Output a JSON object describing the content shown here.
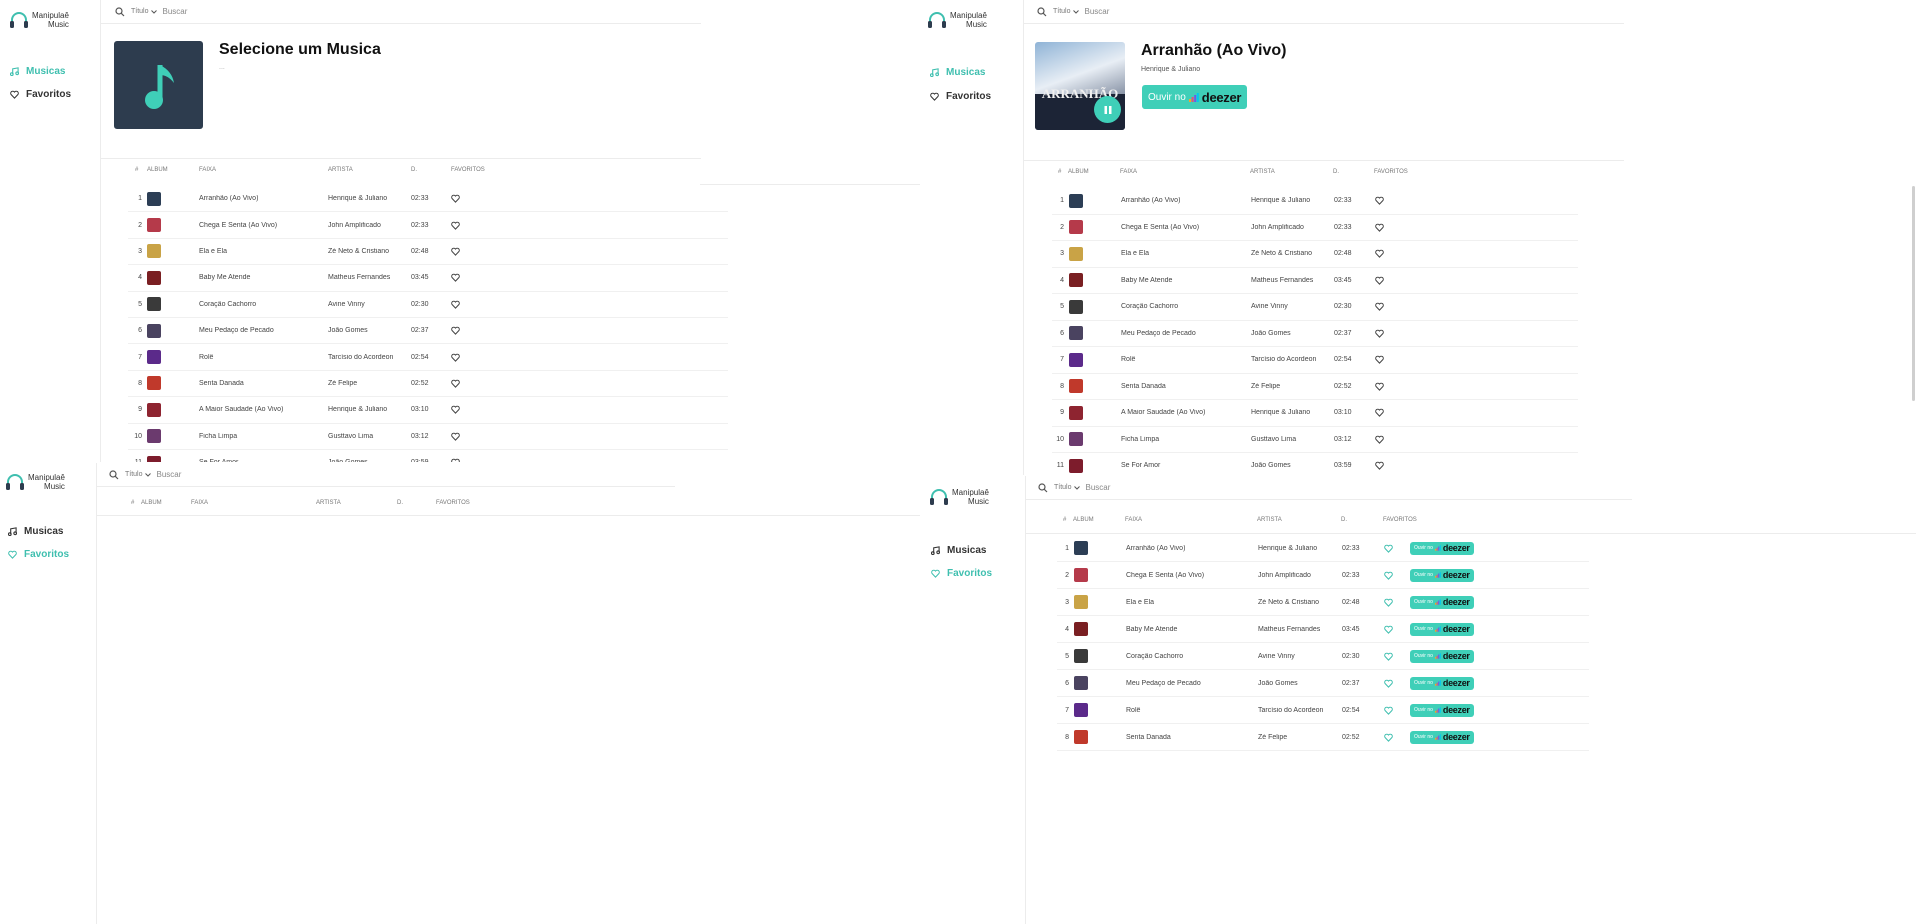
{
  "app": {
    "logo_line1": "Manipulaê",
    "logo_line2": "Music",
    "nav": [
      {
        "label": "Musicas",
        "icon": "music-note-icon"
      },
      {
        "label": "Favoritos",
        "icon": "heart-icon"
      }
    ]
  },
  "search": {
    "filter_label": "Título",
    "placeholder": "Buscar"
  },
  "table_headers": {
    "index": "#",
    "album": "ALBUM",
    "track": "FAIXA",
    "artist": "ARTISTA",
    "duration": "D.",
    "favorites": "FAVORITOS"
  },
  "player_empty": {
    "title": "Selecione um Musica",
    "subtitle": "..."
  },
  "player_playing": {
    "title": "Arranhão (Ao Vivo)",
    "artist": "Henrique & Juliano",
    "cover_text": "ARRANHÃO",
    "cta_prefix": "Ouvir no",
    "cta_brand": "deezer"
  },
  "row_cta": {
    "prefix": "Ouvir no",
    "brand": "deezer"
  },
  "tracks": [
    {
      "n": "1",
      "title": "Arranhão (Ao Vivo)",
      "artist": "Henrique & Juliano",
      "duration": "02:33",
      "color": "#2c3e55"
    },
    {
      "n": "2",
      "title": "Chega E Senta (Ao Vivo)",
      "artist": "John Amplificado",
      "duration": "02:33",
      "color": "#b53a4a"
    },
    {
      "n": "3",
      "title": "Ela e Ela",
      "artist": "Zé Neto & Cristiano",
      "duration": "02:48",
      "color": "#c9a346"
    },
    {
      "n": "4",
      "title": "Baby Me Atende",
      "artist": "Matheus Fernandes",
      "duration": "03:45",
      "color": "#7a1f22"
    },
    {
      "n": "5",
      "title": "Coração Cachorro",
      "artist": "Avine Vinny",
      "duration": "02:30",
      "color": "#3a3a3a"
    },
    {
      "n": "6",
      "title": "Meu Pedaço de Pecado",
      "artist": "João Gomes",
      "duration": "02:37",
      "color": "#4a4360"
    },
    {
      "n": "7",
      "title": "Rolê",
      "artist": "Tarcísio do Acordeon",
      "duration": "02:54",
      "color": "#5b2a8a"
    },
    {
      "n": "8",
      "title": "Senta Danada",
      "artist": "Zé Felipe",
      "duration": "02:52",
      "color": "#c0392b"
    },
    {
      "n": "9",
      "title": "A Maior Saudade (Ao Vivo)",
      "artist": "Henrique & Juliano",
      "duration": "03:10",
      "color": "#8e2430"
    },
    {
      "n": "10",
      "title": "Ficha Limpa",
      "artist": "Gusttavo Lima",
      "duration": "03:12",
      "color": "#6b3a6e"
    },
    {
      "n": "11",
      "title": "Se For Amor",
      "artist": "João Gomes",
      "duration": "03:59",
      "color": "#7d1c2c"
    }
  ],
  "colors": {
    "accent": "#3fbfaf",
    "deezer_button": "#3fcfb8",
    "empty_cover_bg": "#2d3c4e"
  }
}
